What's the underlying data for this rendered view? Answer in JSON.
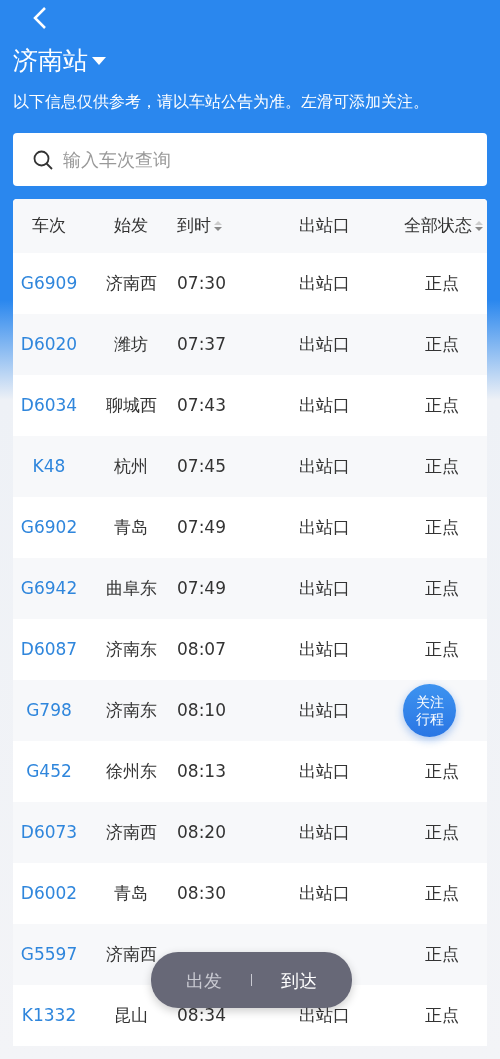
{
  "header": {
    "station": "济南站",
    "notice": "以下信息仅供参考，请以车站公告为准。左滑可添加关注。"
  },
  "search": {
    "placeholder": "输入车次查询"
  },
  "table": {
    "columns": [
      {
        "label": "车次",
        "sortable": false
      },
      {
        "label": "始发",
        "sortable": false
      },
      {
        "label": "到时",
        "sortable": true
      },
      {
        "label": "出站口",
        "sortable": false
      },
      {
        "label": "全部状态",
        "sortable": true
      }
    ],
    "rows": [
      {
        "train": "G6909",
        "origin": "济南西",
        "arrival": "07:30",
        "exit": "出站口",
        "status": "正点"
      },
      {
        "train": "D6020",
        "origin": "潍坊",
        "arrival": "07:37",
        "exit": "出站口",
        "status": "正点"
      },
      {
        "train": "D6034",
        "origin": "聊城西",
        "arrival": "07:43",
        "exit": "出站口",
        "status": "正点"
      },
      {
        "train": "K48",
        "origin": "杭州",
        "arrival": "07:45",
        "exit": "出站口",
        "status": "正点"
      },
      {
        "train": "G6902",
        "origin": "青岛",
        "arrival": "07:49",
        "exit": "出站口",
        "status": "正点"
      },
      {
        "train": "G6942",
        "origin": "曲阜东",
        "arrival": "07:49",
        "exit": "出站口",
        "status": "正点"
      },
      {
        "train": "D6087",
        "origin": "济南东",
        "arrival": "08:07",
        "exit": "出站口",
        "status": "正点"
      },
      {
        "train": "G798",
        "origin": "济南东",
        "arrival": "08:10",
        "exit": "出站口",
        "follow_button": {
          "label": "关注行程"
        }
      },
      {
        "train": "G452",
        "origin": "徐州东",
        "arrival": "08:13",
        "exit": "出站口",
        "status": "正点"
      },
      {
        "train": "D6073",
        "origin": "济南西",
        "arrival": "08:20",
        "exit": "出站口",
        "status": "正点"
      },
      {
        "train": "D6002",
        "origin": "青岛",
        "arrival": "08:30",
        "exit": "出站口",
        "status": "正点"
      },
      {
        "train": "G5597",
        "origin": "济南西",
        "status": "正点"
      },
      {
        "train": "K1332",
        "origin": "昆山",
        "arrival": "08:34",
        "exit": "出站口",
        "status": "正点"
      }
    ]
  },
  "toggle": {
    "options": [
      {
        "label": "出发",
        "selected": false
      },
      {
        "label": "到达",
        "selected": true
      }
    ]
  }
}
